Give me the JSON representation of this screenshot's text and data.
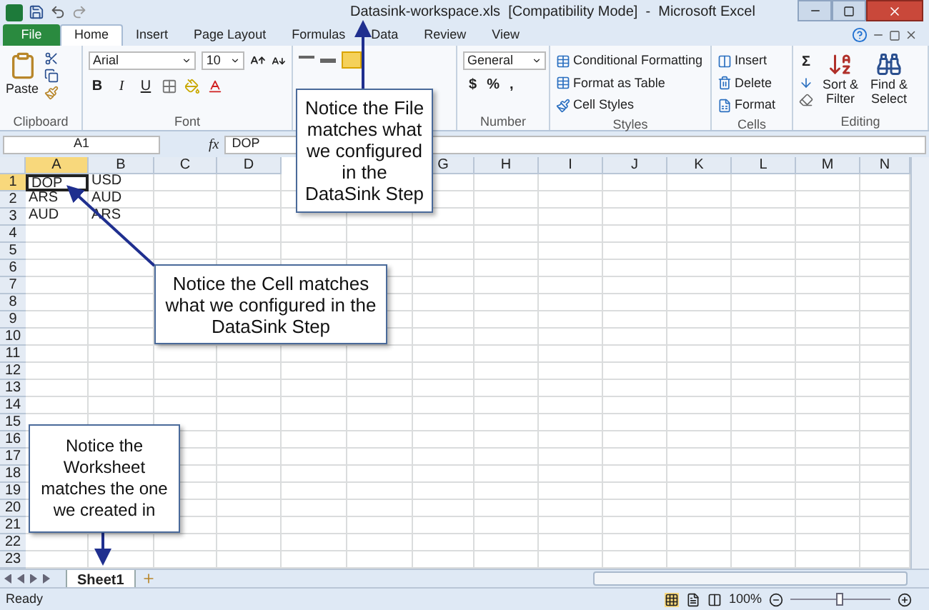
{
  "window": {
    "title": "Datasink-workspace.xls  [Compatibility Mode]  -  Microsoft Excel"
  },
  "tabs": [
    {
      "label": "File",
      "selected": false,
      "kind": "file"
    },
    {
      "label": "Home",
      "selected": true,
      "kind": "tab"
    },
    {
      "label": "Insert",
      "selected": false,
      "kind": "tab"
    },
    {
      "label": "Page Layout",
      "selected": false,
      "kind": "tab"
    },
    {
      "label": "Formulas",
      "selected": false,
      "kind": "tab"
    },
    {
      "label": "Data",
      "selected": false,
      "kind": "tab"
    },
    {
      "label": "Review",
      "selected": false,
      "kind": "tab"
    },
    {
      "label": "View",
      "selected": false,
      "kind": "tab"
    }
  ],
  "ribbon": {
    "clipboard": {
      "label": "Clipboard",
      "paste": "Paste"
    },
    "font": {
      "label": "Font",
      "name": "Arial",
      "size": "10",
      "styles": [
        "B",
        "I",
        "U"
      ]
    },
    "number": {
      "label": "Number",
      "format": "General",
      "symbols": [
        "$",
        "%",
        ","
      ]
    },
    "styles": {
      "label": "Styles",
      "items": [
        "Conditional Formatting",
        "Format as Table",
        "Cell Styles"
      ]
    },
    "cells": {
      "label": "Cells",
      "items": [
        "Insert",
        "Delete",
        "Format"
      ]
    },
    "editing": {
      "label": "Editing",
      "sum": "Σ",
      "items": [
        "Sort & Filter",
        "Find & Select"
      ]
    }
  },
  "formula_bar": {
    "name_box": "A1",
    "fx": "fx",
    "value": "DOP"
  },
  "columns": [
    {
      "label": "A",
      "selected": true
    },
    {
      "label": "B",
      "selected": false
    },
    {
      "label": "C",
      "selected": false
    },
    {
      "label": "D",
      "selected": false
    },
    {
      "label": "G",
      "selected": false
    },
    {
      "label": "H",
      "selected": false
    },
    {
      "label": "I",
      "selected": false
    },
    {
      "label": "J",
      "selected": false
    },
    {
      "label": "K",
      "selected": false
    },
    {
      "label": "L",
      "selected": false
    },
    {
      "label": "M",
      "selected": false
    },
    {
      "label": "N",
      "selected": false
    }
  ],
  "rows": [
    {
      "header": "1",
      "selected": true,
      "cells": [
        {
          "text": "DOP",
          "selected": true
        },
        {
          "text": "USD",
          "selected": false
        }
      ]
    },
    {
      "header": "2",
      "selected": false,
      "cells": [
        {
          "text": "ARS",
          "selected": false
        },
        {
          "text": "AUD",
          "selected": false
        }
      ]
    },
    {
      "header": "3",
      "selected": false,
      "cells": [
        {
          "text": "AUD",
          "selected": false
        },
        {
          "text": "ARS",
          "selected": false
        }
      ]
    },
    {
      "header": "4",
      "selected": false
    },
    {
      "header": "5",
      "selected": false
    },
    {
      "header": "6",
      "selected": false
    },
    {
      "header": "7",
      "selected": false
    },
    {
      "header": "8",
      "selected": false
    },
    {
      "header": "9",
      "selected": false
    },
    {
      "header": "10",
      "selected": false
    },
    {
      "header": "11",
      "selected": false
    },
    {
      "header": "12",
      "selected": false
    },
    {
      "header": "13",
      "selected": false
    },
    {
      "header": "14",
      "selected": false
    },
    {
      "header": "15",
      "selected": false
    },
    {
      "header": "16",
      "selected": false
    },
    {
      "header": "17",
      "selected": false
    },
    {
      "header": "18",
      "selected": false
    },
    {
      "header": "19",
      "selected": false
    },
    {
      "header": "20",
      "selected": false
    },
    {
      "header": "21",
      "selected": false
    },
    {
      "header": "22",
      "selected": false
    },
    {
      "header": "23",
      "selected": false
    }
  ],
  "sheets": [
    {
      "label": "Sheet1",
      "selected": true
    }
  ],
  "status_bar": {
    "text": "Ready",
    "zoom": "100%",
    "zoom_slider": {
      "level": 0.5
    }
  },
  "callouts": [
    {
      "text": "Notice the File matches what we configured in the DataSink Step"
    },
    {
      "text": "Notice the Cell matches what we configured in the DataSink Step"
    },
    {
      "text": "Notice the Worksheet matches the one we created in"
    }
  ]
}
